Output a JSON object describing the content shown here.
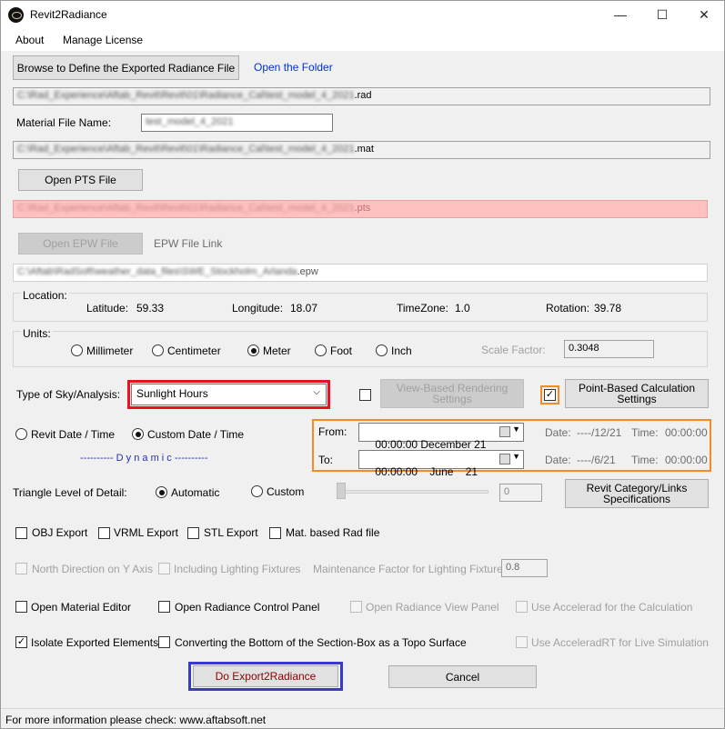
{
  "window": {
    "title": "Revit2Radiance",
    "minimize_glyph": "—",
    "maximize_glyph": "☐",
    "close_glyph": "✕"
  },
  "menu": {
    "about": "About",
    "manage_license": "Manage License"
  },
  "export_file": {
    "browse_label": "Browse to Define the Exported Radiance File",
    "open_folder_label": "Open the Folder",
    "path_blurred": "C:\\Rad_Experience\\Aftab_Revit\\Revit\\01\\Radiance_Cal\\test_model_4_2021",
    "path_ext": ".rad"
  },
  "material": {
    "label": "Material File Name:",
    "name_blurred": "test_model_4_2021",
    "path_blurred": "C:\\Rad_Experience\\Aftab_Revit\\Revit\\01\\Radiance_Cal\\test_model_4_2021",
    "path_ext": ".mat"
  },
  "pts": {
    "button_label": "Open PTS File",
    "path_blurred": "C:\\Rad_Experience\\Aftab_Revit\\Revit\\01\\Radiance_Cal\\test_model_4_2021",
    "path_ext": ".pts"
  },
  "epw": {
    "button_label": "Open EPW File",
    "link_label": "EPW File Link",
    "path_blurred": "C:\\Aftab\\RadSoft\\weather_data_files\\SWE_Stockholm_Arlanda",
    "path_ext": ".epw"
  },
  "location": {
    "group_label": "Location:",
    "latitude_label": "Latitude:",
    "latitude_value": "59.33",
    "longitude_label": "Longitude:",
    "longitude_value": "18.07",
    "timezone_label": "TimeZone:",
    "timezone_value": "1.0",
    "rotation_label": "Rotation:",
    "rotation_value": "39.78"
  },
  "units": {
    "group_label": "Units:",
    "options": [
      "Millimeter",
      "Centimeter",
      "Meter",
      "Foot",
      "Inch"
    ],
    "selected": "Meter",
    "scale_label": "Scale Factor:",
    "scale_value": "0.3048"
  },
  "sky": {
    "label": "Type of Sky/Analysis:",
    "selected": "Sunlight Hours",
    "view_based_label": "View-Based Rendering Settings",
    "point_based_label": "Point-Based Calculation Settings",
    "view_based_checked": false,
    "point_based_checked": true,
    "highlight_color": "#e81123",
    "point_highlight_color": "#f28c28"
  },
  "date": {
    "revit_label": "Revit Date / Time",
    "custom_label": "Custom Date / Time",
    "selected": "Custom Date / Time",
    "dynamic_label": "---------- D y n a m i c ----------",
    "from_label": "From:",
    "from_value": "00:00:00 December 21",
    "to_label": "To:",
    "to_value": "00:00:00    June    21",
    "from_date_label": "Date:",
    "from_date_value": "----/12/21",
    "from_time_label": "Time:",
    "from_time_value": "00:00:00",
    "to_date_label": "Date:",
    "to_date_value": "----/6/21",
    "to_time_label": "Time:",
    "to_time_value": "00:00:00",
    "highlight_color": "#f28c28"
  },
  "triangle": {
    "label": "Triangle Level of Detail:",
    "automatic_label": "Automatic",
    "custom_label": "Custom",
    "selected": "Automatic",
    "value": "0",
    "category_button": "Revit Category/Links Specifications"
  },
  "exports": {
    "obj": "OBJ Export",
    "vrml": "VRML Export",
    "stl": "STL Export",
    "mat": "Mat. based Rad file"
  },
  "options_disabled": {
    "north": "North Direction on Y Axis",
    "fixtures": "Including Lighting Fixtures",
    "maintenance_label": "Maintenance Factor for Lighting Fixtures:",
    "maintenance_value": "0.8"
  },
  "panels": {
    "material_editor": "Open Material Editor",
    "control_panel": "Open Radiance Control Panel",
    "view_panel": "Open Radiance View Panel",
    "accelerad": "Use Accelerad for the Calculation"
  },
  "extra": {
    "isolate": "Isolate Exported Elements",
    "isolate_checked": true,
    "topo": "Converting the Bottom of the Section-Box as a Topo Surface",
    "accelerad_rt": "Use AcceleradRT for Live Simulation"
  },
  "actions": {
    "export_label": "Do Export2Radiance",
    "cancel_label": "Cancel",
    "export_text_color": "#8b0000",
    "export_highlight_color": "#3a3ac8"
  },
  "status": {
    "text": "For more information please check: www.aftabsoft.net"
  }
}
